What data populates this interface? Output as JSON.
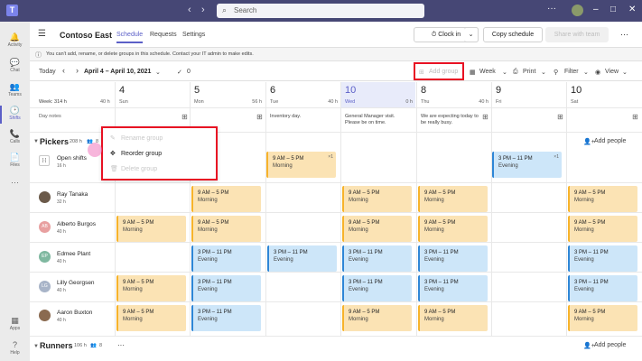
{
  "titlebar": {
    "search_placeholder": "Search",
    "logo": "T",
    "more": "···"
  },
  "rail": [
    {
      "icon": "🔔",
      "label": "Activity",
      "name": "activity"
    },
    {
      "icon": "💬",
      "label": "Chat",
      "name": "chat"
    },
    {
      "icon": "👥",
      "label": "Teams",
      "name": "teams"
    },
    {
      "icon": "🕑",
      "label": "Shifts",
      "name": "shifts",
      "active": true
    },
    {
      "icon": "📞",
      "label": "Calls",
      "name": "calls"
    },
    {
      "icon": "📄",
      "label": "Files",
      "name": "files"
    },
    {
      "icon": "···",
      "label": "",
      "name": "more"
    },
    {
      "icon": "▦",
      "label": "Apps",
      "name": "apps"
    },
    {
      "icon": "?",
      "label": "Help",
      "name": "help"
    }
  ],
  "header": {
    "title": "Contoso East",
    "tabs": [
      "Schedule",
      "Requests",
      "Settings"
    ],
    "clock_in": "Clock in",
    "copy_schedule": "Copy schedule",
    "share": "Share with team"
  },
  "infobar": {
    "text": "You can't add, rename, or delete groups in this schedule. Contact your IT admin to make edits."
  },
  "toolbar": {
    "today": "Today",
    "range": "April 4 – April 10, 2021",
    "check_count": "0",
    "add_group": "Add group",
    "week": "Week",
    "print": "Print",
    "filter": "Filter",
    "view": "View"
  },
  "week": {
    "label": "Week: 314 h",
    "hours": "40 h",
    "day_notes": "Day notes"
  },
  "days": [
    {
      "num": "4",
      "name": "Sun",
      "hours": "40 h",
      "note": ""
    },
    {
      "num": "5",
      "name": "Mon",
      "hours": "56 h",
      "note": ""
    },
    {
      "num": "6",
      "name": "Tue",
      "hours": "40 h",
      "note": "Inventory day."
    },
    {
      "num": "10",
      "name": "Wed",
      "hours": "0 h",
      "note": "General Manager visit. Please be on time.",
      "today": true
    },
    {
      "num": "8",
      "name": "Thu",
      "hours": "40 h",
      "note": "We are expecting today to be really busy."
    },
    {
      "num": "9",
      "name": "Fri",
      "hours": "",
      "note": ""
    },
    {
      "num": "10",
      "name": "Sat",
      "hours": "",
      "note": ""
    }
  ],
  "groups": {
    "pickers": {
      "name": "Pickers",
      "hours": "208 h",
      "count": "8",
      "add_people": "Add people"
    },
    "runners": {
      "name": "Runners",
      "hours": "106 h",
      "count": "8",
      "add_people": "Add people"
    }
  },
  "open_shifts": {
    "label": "Open shifts",
    "hours": "16 h"
  },
  "members": [
    {
      "name": "Ray Tanaka",
      "hours": "32 h",
      "initials": "",
      "color": "#6b5a4a"
    },
    {
      "name": "Alberto Burgos",
      "hours": "40 h",
      "initials": "AB",
      "color": "#e8a0a0"
    },
    {
      "name": "Edmee Plant",
      "hours": "40 h",
      "initials": "EP",
      "color": "#7fb8a0"
    },
    {
      "name": "Lilly Georgsen",
      "hours": "40 h",
      "initials": "LG",
      "color": "#a8b4c8"
    },
    {
      "name": "Aaron Buxton",
      "hours": "40 h",
      "initials": "",
      "color": "#8a6a50"
    }
  ],
  "shift_labels": {
    "morning_time": "9 AM – 5 PM",
    "morning": "Morning",
    "evening_time": "3 PM – 11 PM",
    "evening": "Evening",
    "open_badge": "×1"
  },
  "context_menu": {
    "rename": "Rename group",
    "reorder": "Reorder group",
    "delete": "Delete group"
  }
}
